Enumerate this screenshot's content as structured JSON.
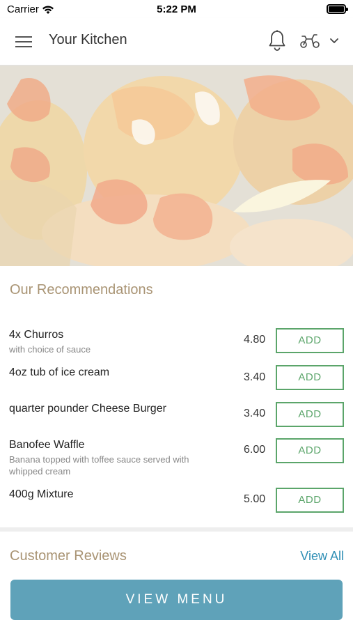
{
  "status_bar": {
    "carrier": "Carrier",
    "time": "5:22 PM"
  },
  "header": {
    "title": "Your Kitchen"
  },
  "recommendations": {
    "title": "Our Recommendations",
    "items": [
      {
        "name": "4x Churros",
        "description": "with choice of sauce",
        "price": "4.80",
        "button": "ADD"
      },
      {
        "name": "4oz tub of ice cream",
        "description": "",
        "price": "3.40",
        "button": "ADD"
      },
      {
        "name": "quarter pounder Cheese Burger",
        "description": "",
        "price": "3.40",
        "button": "ADD"
      },
      {
        "name": "Banofee Waffle",
        "description": "Banana topped with toffee sauce served with whipped cream",
        "price": "6.00",
        "button": "ADD"
      },
      {
        "name": "400g Mixture",
        "description": "",
        "price": "5.00",
        "button": "ADD"
      }
    ]
  },
  "reviews": {
    "title": "Customer Reviews",
    "link": "View All"
  },
  "footer": {
    "button": "VIEW MENU"
  },
  "colors": {
    "accent_gold": "#a99474",
    "add_green": "#5ba56a",
    "link_blue": "#2f8fb5",
    "menu_button": "#5fa2b9"
  }
}
